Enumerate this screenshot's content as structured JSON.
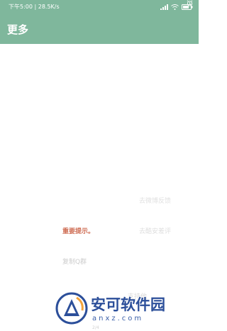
{
  "status_bar": {
    "time_speed": "下午5:00 | 28.5K/s",
    "battery_level": 80,
    "icons": [
      "alarm-icon",
      "signal-icon",
      "wifi-icon",
      "battery-icon"
    ]
  },
  "app_bar": {
    "title": "更多",
    "color": "#7fb79c"
  },
  "menu": {
    "weibo_feedback": "去微博反馈",
    "important_notice": "重要提示。",
    "rate_app": "去酷安差评",
    "copy_qq_group": "复制Q群",
    "support_author": "支持他",
    "footer_tiny": "2/4"
  },
  "watermark": {
    "title": "安可软件园",
    "url": "anxz.com"
  }
}
